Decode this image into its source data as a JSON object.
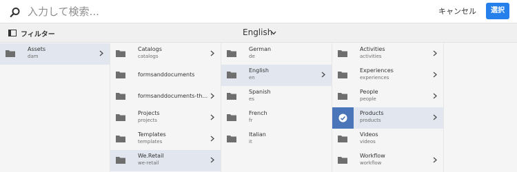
{
  "search": {
    "placeholder": "入力して検索..."
  },
  "header_actions": {
    "cancel_label": "キャンセル",
    "select_label": "選択"
  },
  "toolbar": {
    "filter_label": "フィルター",
    "language": "English"
  },
  "columns": [
    {
      "items": [
        {
          "title": "Assets",
          "subtitle": "dam",
          "has_children": true,
          "selected": true
        }
      ]
    },
    {
      "items": [
        {
          "title": "Catalogs",
          "subtitle": "catalogs",
          "has_children": true
        },
        {
          "title": "formsanddocuments",
          "subtitle": "",
          "has_children": false
        },
        {
          "title": "formsanddocuments-th...",
          "subtitle": "",
          "has_children": true
        },
        {
          "title": "Projects",
          "subtitle": "projects",
          "has_children": true
        },
        {
          "title": "Templates",
          "subtitle": "templates",
          "has_children": true
        },
        {
          "title": "We.Retail",
          "subtitle": "we-retail",
          "has_children": true,
          "selected": true
        }
      ]
    },
    {
      "items": [
        {
          "title": "German",
          "subtitle": "de",
          "has_children": false
        },
        {
          "title": "English",
          "subtitle": "en",
          "has_children": true,
          "selected": true
        },
        {
          "title": "Spanish",
          "subtitle": "es",
          "has_children": false
        },
        {
          "title": "French",
          "subtitle": "fr",
          "has_children": false
        },
        {
          "title": "Italian",
          "subtitle": "it",
          "has_children": false
        }
      ]
    },
    {
      "items": [
        {
          "title": "Activities",
          "subtitle": "activities",
          "has_children": true
        },
        {
          "title": "Experiences",
          "subtitle": "experiences",
          "has_children": true
        },
        {
          "title": "People",
          "subtitle": "people",
          "has_children": true
        },
        {
          "title": "Products",
          "subtitle": "products",
          "has_children": true,
          "selected": true,
          "checked": true
        },
        {
          "title": "Videos",
          "subtitle": "videos",
          "has_children": false
        },
        {
          "title": "Workflow",
          "subtitle": "workflow",
          "has_children": true
        }
      ]
    }
  ],
  "colors": {
    "accent": "#2680eb",
    "selected_row": "#e1e6ef",
    "checked_thumb": "#4b75b9"
  }
}
